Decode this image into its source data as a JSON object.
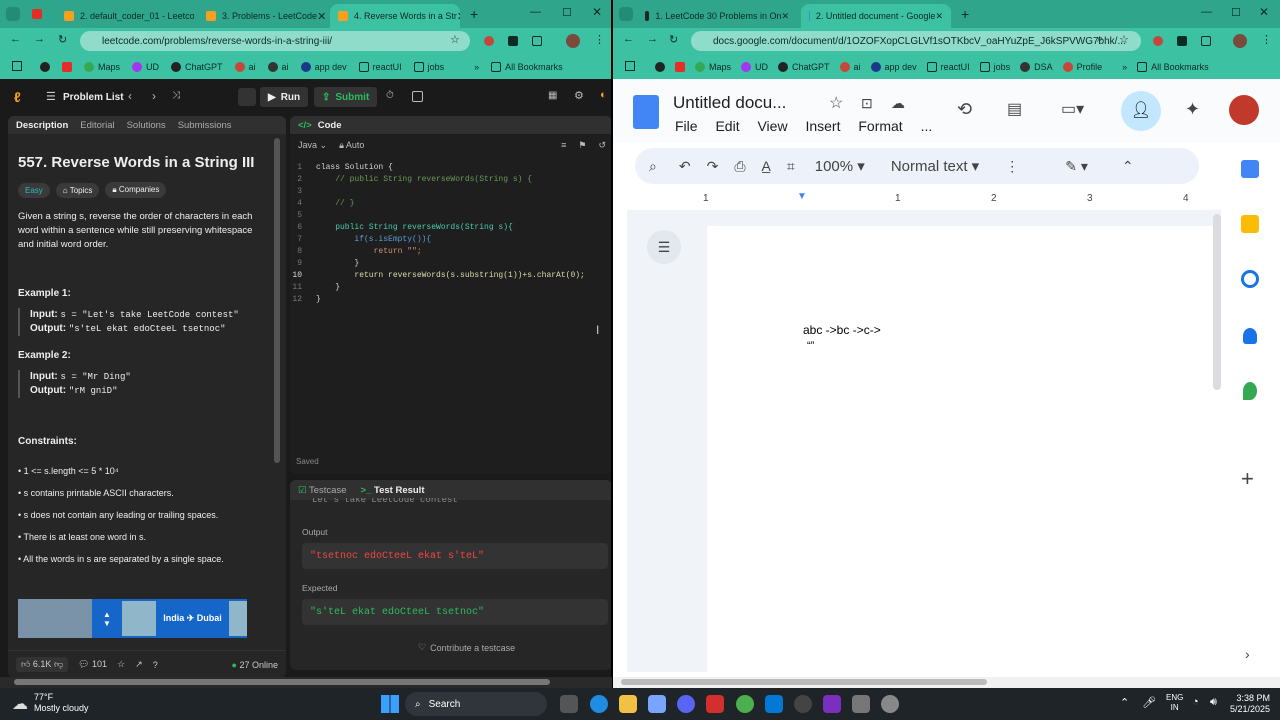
{
  "left_browser": {
    "tabs": [
      {
        "label": "2. default_coder_01 - Leetco"
      },
      {
        "label": "3. Problems - LeetCode"
      },
      {
        "label": "4. Reverse Words in a Str"
      }
    ],
    "url": "leetcode.com/problems/reverse-words-in-a-string-iii/",
    "bookmarks": [
      "Maps",
      "UD",
      "ChatGPT",
      "ai",
      "ai",
      "app dev",
      "reactUI",
      "jobs"
    ],
    "all_bookmarks": "All Bookmarks"
  },
  "leetcode": {
    "problem_list": "Problem List",
    "run": "Run",
    "submit": "Submit",
    "tabs": [
      "Description",
      "Editorial",
      "Solutions",
      "Submissions"
    ],
    "title": "557. Reverse Words in a String III",
    "difficulty": "Easy",
    "topics": "Topics",
    "companies": "Companies",
    "statement": "Given a string s, reverse the order of characters in each word within a sentence while still preserving whitespace and initial word order.",
    "ex1_h": "Example 1:",
    "ex1_in_label": "Input:",
    "ex1_in": "s = \"Let's take LeetCode contest\"",
    "ex1_out_label": "Output:",
    "ex1_out": "\"s'teL ekat edoCteeL tsetnoc\"",
    "ex2_h": "Example 2:",
    "ex2_in_label": "Input:",
    "ex2_in": "s = \"Mr Ding\"",
    "ex2_out_label": "Output:",
    "ex2_out": "\"rM gniD\"",
    "constraints_h": "Constraints:",
    "constraints": [
      "1 <= s.length <= 5 * 10⁴",
      "s contains printable ASCII characters.",
      "s does not contain any leading or trailing spaces.",
      "There is at least one word in s.",
      "All the words in s are separated by a single space."
    ],
    "ad_text": "India ✈ Dubai",
    "likes": "6.1K",
    "comments": "101",
    "online": "27 Online",
    "code_title": "Code",
    "lang": "Java",
    "auto": "Auto",
    "code_lines": [
      "class Solution {",
      "    // public String reverseWords(String s) {",
      "",
      "    // }",
      "",
      "    public String reverseWords(String s){",
      "        if(s.isEmpty()){",
      "            return \"\";",
      "        }",
      "        return reverseWords(s.substring(1))+s.charAt(0);",
      "    }",
      "}"
    ],
    "saved": "Saved",
    "testcase": "Testcase",
    "test_result": "Test Result",
    "input_partial": "Let's take LeetCode contest",
    "output_label": "Output",
    "output": "\"tsetnoc edoCteeL ekat s'teL\"",
    "expected_label": "Expected",
    "expected": "\"s'teL ekat edoCteeL tsetnoc\"",
    "contribute": "Contribute a testcase"
  },
  "right_browser": {
    "tabs": [
      {
        "label": "1. LeetCode 30 Problems in On"
      },
      {
        "label": "2. Untitled document - Google"
      }
    ],
    "url": "docs.google.com/document/d/1OZOFXopCLGLVf1sOTKbcV_oaHYuZpE_J6kSPVWG7bhk/...",
    "bookmarks": [
      "Maps",
      "UD",
      "ChatGPT",
      "ai",
      "app dev",
      "reactUI",
      "jobs",
      "DSA",
      "Profile"
    ],
    "all_bookmarks": "All Bookmarks"
  },
  "gdoc": {
    "title": "Untitled docu...",
    "menu": [
      "File",
      "Edit",
      "View",
      "Insert",
      "Format",
      "..."
    ],
    "zoom": "100%",
    "style": "Normal text",
    "ruler": [
      "1",
      "1",
      "2",
      "3",
      "4"
    ],
    "line1": "abc ->bc ->c->",
    "line2": "“”"
  },
  "taskbar": {
    "temp": "77°F",
    "weather": "Mostly cloudy",
    "search": "Search",
    "lang1": "ENG",
    "lang2": "IN",
    "time": "3:38 PM",
    "date": "5/21/2025"
  }
}
